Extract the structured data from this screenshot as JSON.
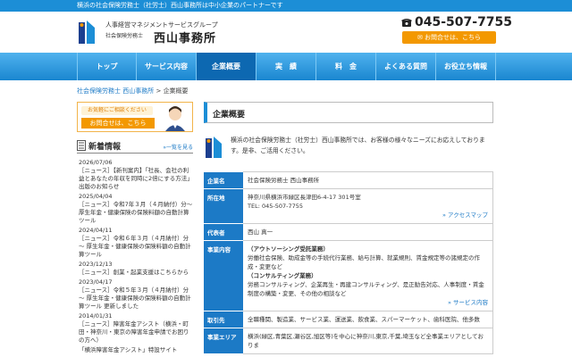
{
  "topbar": {
    "text": "横浜の社会保険労務士（社労士）西山事務所は中小企業のパートナーです"
  },
  "header": {
    "tagline": "人事経営マネジメントサービスグループ",
    "office_type": "社会保険労務士",
    "office_name": "西山事務所",
    "phone": "045-507-7755",
    "contact_button": "お問合せは、こちら"
  },
  "nav": {
    "items": [
      {
        "label": "トップ"
      },
      {
        "label": "サービス内容"
      },
      {
        "label": "企業概要"
      },
      {
        "label": "実　績"
      },
      {
        "label": "料　金"
      },
      {
        "label": "よくある質問"
      },
      {
        "label": "お役立ち情報"
      }
    ],
    "active_index": 2
  },
  "breadcrumb": {
    "home": "社会保険労務士 西山事務所",
    "separator": " > ",
    "current": "企業概要"
  },
  "sidebar": {
    "banner_top": "お気軽にご相談ください",
    "banner_button": "お問合せは、こちら",
    "news_title": "新着情報",
    "news_more": "一覧を見る",
    "news": [
      {
        "date": "2026/07/06",
        "text": "［ニュース］【新刊案内】「社長、会社の利益とあなたの年収を同時に2倍にする方法」出版のお知らせ"
      },
      {
        "date": "2025/04/04",
        "text": "［ニュース］令和7年３月（４月納付）分～ 厚生年金・健康保険の保険料額の自動計算ツール"
      },
      {
        "date": "2024/04/11",
        "text": "［ニュース］令和６年３月（４月納付）分～ 厚生年金・健康保険の保険料額の自動計算ツール"
      },
      {
        "date": "2023/12/13",
        "text": "［ニュース］創業・起業支援はこちらから"
      },
      {
        "date": "2023/04/17",
        "text": "［ニュース］令和５年３月（４月納付）分～ 厚生年金・健康保険の保険料額の自動計算ツール 更新しました"
      },
      {
        "date": "2014/01/31",
        "text": "［ニュース］障害年金アシスト（横浜・町田・神奈川・東京の障害年金申請でお困りの方へ）"
      },
      {
        "date": "",
        "text": "「横浜障害年金アシスト」特設サイト"
      }
    ]
  },
  "main": {
    "title": "企業概要",
    "intro": "横浜の社会保険労務士（社労士）西山事務所では、お客様の様々なニーズにお応えしております。是非、ご活用ください。",
    "access_link": "アクセスマップ",
    "service_link": "サービス内容",
    "table": {
      "company_label": "企業名",
      "company_value": "社会保険労務士 西山事務所",
      "address_label": "所在地",
      "address_value": "神奈川県横浜市緑区長津田6-4-17 301号室",
      "tel_value": "TEL: 045-507-7755",
      "rep_label": "代表者",
      "rep_value": "西山 真一",
      "business_label": "事業内容",
      "biz1_head": "（アウトソーシング受託業務）",
      "biz1_text": "労働社会保険、助成金等の手続代行業務、給与計算、就業規則、賃金規定等の諸規定の作成・変更など",
      "biz2_head": "（コンサルティング業務）",
      "biz2_text": "労務コンサルティング、企業再生・再建コンサルティング、是正勧告対応、人事制度・賃金制度の構築・変更、その他の相談など",
      "clients_label": "取引先",
      "clients_value": "全職種関、製造業、サービス業、運送業、飲食業、スパーマーケット、歯科医院、他多数",
      "area_label": "事業エリア",
      "area_value": "横浜(緑区,青葉区,瀬谷区,旭区等)を中心に神奈川,東京,千葉,埼玉など全事業エリアとしておりま"
    }
  },
  "colors": {
    "brand_blue": "#1c8ed6",
    "accent_orange": "#f39800"
  }
}
